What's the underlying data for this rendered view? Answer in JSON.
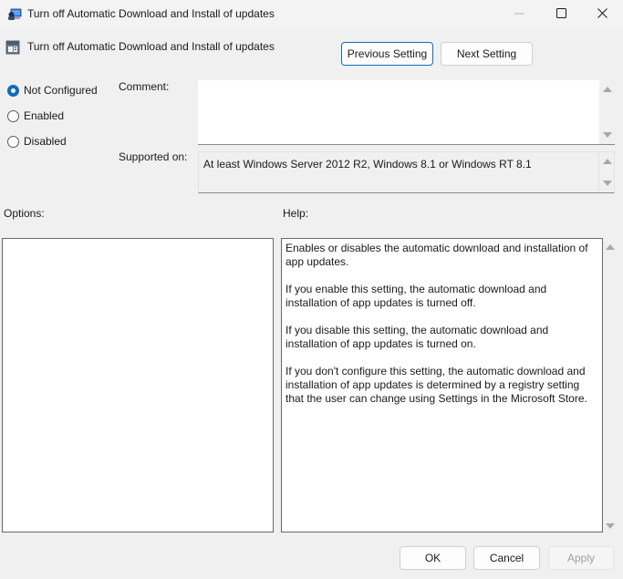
{
  "window": {
    "title": "Turn off Automatic Download and Install of updates",
    "controls": {
      "minimize": "minimize",
      "maximize": "maximize",
      "close": "close"
    }
  },
  "header": {
    "policy_name": "Turn off Automatic Download and Install of updates",
    "previous_label": "Previous Setting",
    "next_label": "Next Setting"
  },
  "state": {
    "options": [
      {
        "label": "Not Configured",
        "checked": true
      },
      {
        "label": "Enabled",
        "checked": false
      },
      {
        "label": "Disabled",
        "checked": false
      }
    ]
  },
  "comment": {
    "label": "Comment:",
    "value": ""
  },
  "supported": {
    "label": "Supported on:",
    "value": "At least Windows Server 2012 R2, Windows 8.1 or Windows RT 8.1"
  },
  "options_panel": {
    "label": "Options:"
  },
  "help_panel": {
    "label": "Help:",
    "paragraphs": [
      "Enables or disables the automatic download and installation of app updates.",
      "If you enable this setting, the automatic download and installation of app updates is turned off.",
      "If you disable this setting, the automatic download and installation of app updates is turned on.",
      "If you don't configure this setting, the automatic download and installation of app updates is determined by a registry setting that the user can change using Settings in the Microsoft Store."
    ]
  },
  "footer": {
    "ok_label": "OK",
    "cancel_label": "Cancel",
    "apply_label": "Apply",
    "apply_enabled": false
  },
  "colors": {
    "accent": "#0f6cbd",
    "background": "#f0f0f0"
  }
}
